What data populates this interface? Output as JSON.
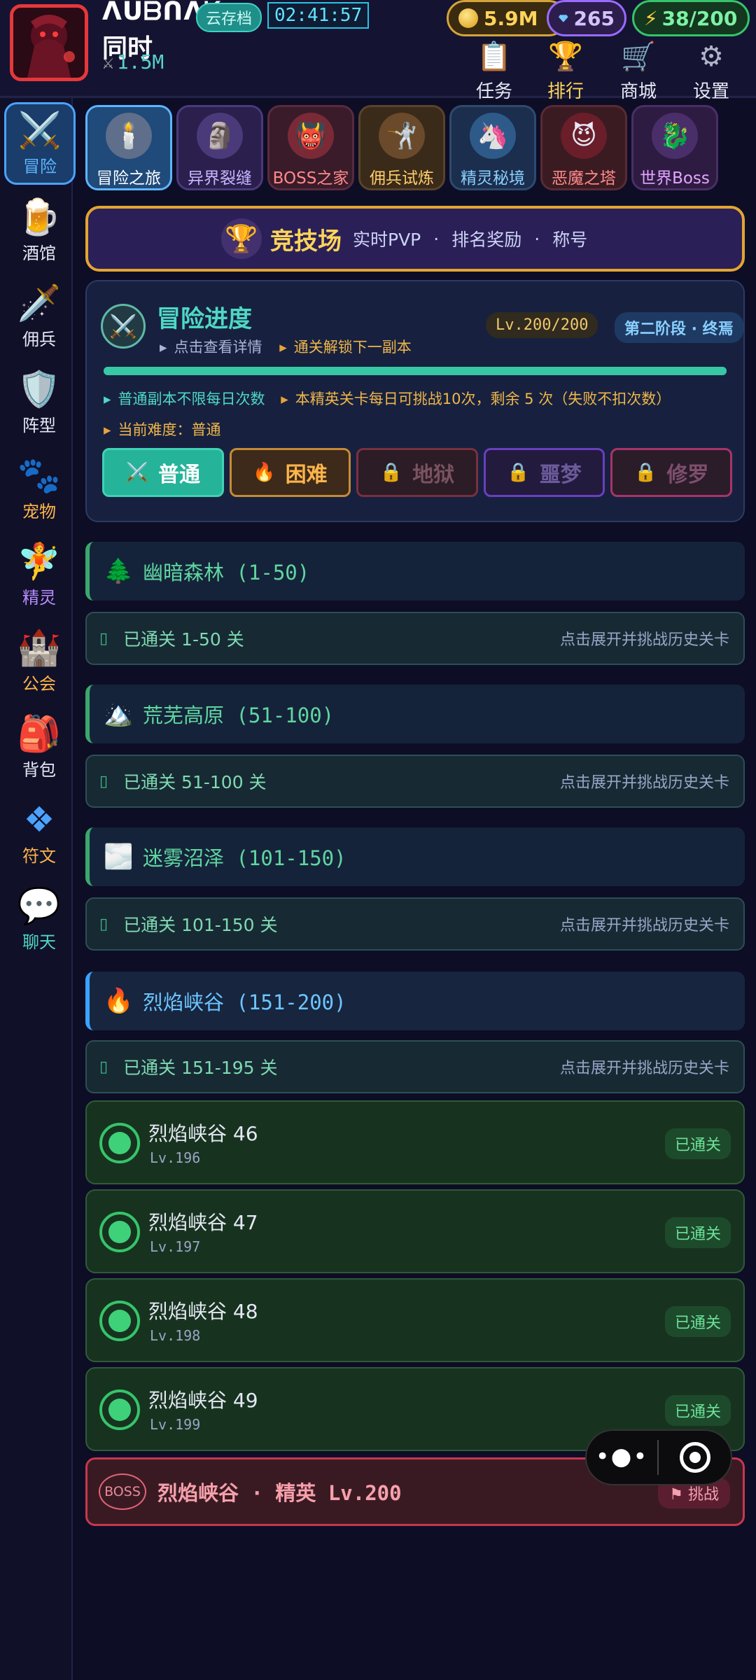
{
  "header": {
    "player_name": "ᐱᑌᗷᑎᐱᏦ",
    "cloud_save_label": "云存档",
    "clock": "02:41:57",
    "status_text": "同时",
    "power": "1.5M",
    "resources": {
      "gold": "5.9M",
      "gems": "265",
      "energy": "38/200"
    },
    "nav": [
      {
        "label": "任务",
        "icon": "clipboard-icon"
      },
      {
        "label": "排行",
        "icon": "trophy-icon"
      },
      {
        "label": "商城",
        "icon": "cart-icon"
      },
      {
        "label": "设置",
        "icon": "gear-icon"
      }
    ]
  },
  "sidebar": {
    "items": [
      {
        "label": "冒险",
        "icon": "crossed-swords-icon",
        "color": "#5cb6ff"
      },
      {
        "label": "酒馆",
        "icon": "beer-icon",
        "color": "#e6e8f5"
      },
      {
        "label": "佣兵",
        "icon": "dagger-icon",
        "color": "#e6e8f5"
      },
      {
        "label": "阵型",
        "icon": "shield-icon",
        "color": "#e6e8f5"
      },
      {
        "label": "宠物",
        "icon": "paw-icon",
        "color": "#ffb54a"
      },
      {
        "label": "精灵",
        "icon": "fairy-icon",
        "color": "#b88cff"
      },
      {
        "label": "公会",
        "icon": "castle-icon",
        "color": "#ffb54a"
      },
      {
        "label": "背包",
        "icon": "backpack-icon",
        "color": "#e6e8f5"
      },
      {
        "label": "符文",
        "icon": "rune-icon",
        "color": "#ffb54a"
      },
      {
        "label": "聊天",
        "icon": "chat-icon",
        "color": "#4fd8c4"
      }
    ]
  },
  "tabs": [
    {
      "label": "冒险之旅",
      "icon": "torch-icon",
      "color": "#ffffff"
    },
    {
      "label": "异界裂缝",
      "icon": "golem-icon",
      "color": "#c9b6ff"
    },
    {
      "label": "BOSS之家",
      "icon": "demon-icon",
      "color": "#ff8a8a"
    },
    {
      "label": "佣兵试炼",
      "icon": "warrior-icon",
      "color": "#ffcf6b"
    },
    {
      "label": "精灵秘境",
      "icon": "unicorn-icon",
      "color": "#8ad0ff"
    },
    {
      "label": "恶魔之塔",
      "icon": "devil-icon",
      "color": "#ff8a8a"
    },
    {
      "label": "世界Boss",
      "icon": "dragon-icon",
      "color": "#e3a6ff"
    }
  ],
  "arena": {
    "title": "竞技场",
    "subtitle_1": "实时PVP",
    "separator": "·",
    "subtitle_2": "排名奖励",
    "subtitle_3": "称号"
  },
  "progress": {
    "title": "冒险进度",
    "link_details": "点击查看详情",
    "link_unlock": "通关解锁下一副本",
    "level": "Lv.200/200",
    "stage": "第二阶段 · 终焉",
    "fraction": 1.0,
    "info_normal": "普通副本不限每日次数",
    "info_elite": "本精英关卡每日可挑战10次，剩余 5 次（失败不扣次数）",
    "difficulty_label": "当前难度：普通",
    "difficulties": [
      {
        "label": "普通",
        "locked": false
      },
      {
        "label": "困难",
        "locked": false
      },
      {
        "label": "地狱",
        "locked": true
      },
      {
        "label": "噩梦",
        "locked": true
      },
      {
        "label": "修罗",
        "locked": true
      }
    ]
  },
  "sections": [
    {
      "title": "幽暗森林 (1-50)",
      "icon": "tree-icon",
      "cleared": "已通关 1-50 关"
    },
    {
      "title": "荒芜高原 (51-100)",
      "icon": "mountain-icon",
      "cleared": "已通关 51-100 关"
    },
    {
      "title": "迷雾沼泽 (101-150)",
      "icon": "fog-icon",
      "cleared": "已通关 101-150 关"
    },
    {
      "title": "烈焰峡谷 (151-200)",
      "icon": "fire-icon",
      "cleared": "已通关 151-195 关"
    }
  ],
  "expand_hint": "点击展开并挑战历史关卡",
  "stages": [
    {
      "name": "烈焰峡谷 46",
      "level": "Lv.196",
      "status": "已通关"
    },
    {
      "name": "烈焰峡谷 47",
      "level": "Lv.197",
      "status": "已通关"
    },
    {
      "name": "烈焰峡谷 48",
      "level": "Lv.198",
      "status": "已通关"
    },
    {
      "name": "烈焰峡谷 49",
      "level": "Lv.199",
      "status": "已通关"
    }
  ],
  "boss": {
    "badge": "BOSS",
    "title": "烈焰峡谷 · 精英 Lv.200",
    "button": "挑战"
  }
}
